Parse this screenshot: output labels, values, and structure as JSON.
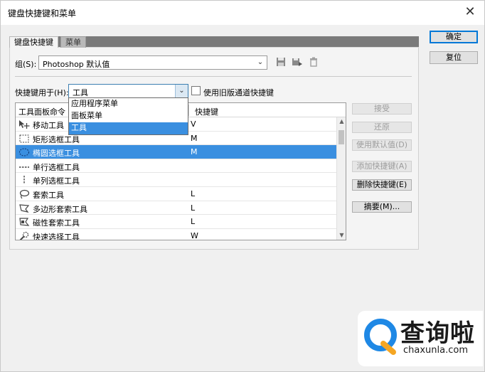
{
  "window": {
    "title": "键盘快捷键和菜单",
    "close_glyph": "✕"
  },
  "tabs": [
    {
      "label": "键盘快捷键",
      "active": true
    },
    {
      "label": "菜单",
      "active": false
    }
  ],
  "group": {
    "label": "组(S):",
    "value": "Photoshop 默认值"
  },
  "shortcuts_for": {
    "label": "快捷键用于(H):",
    "value": "工具",
    "options": [
      "应用程序菜单",
      "面板菜单",
      "工具"
    ],
    "selected_option": "工具"
  },
  "legacy_channel": {
    "label": "使用旧版通道快捷键",
    "checked": false
  },
  "table": {
    "headers": {
      "command": "工具面板命令",
      "shortcut": "快捷键"
    },
    "rows": [
      {
        "icon": "move-tool-icon",
        "name": "移动工具",
        "key": "V",
        "selected": false
      },
      {
        "icon": "rect-marquee-icon",
        "name": "矩形选框工具",
        "key": "M",
        "selected": false
      },
      {
        "icon": "ellipse-marquee-icon",
        "name": "椭圆选框工具",
        "key": "M",
        "selected": true
      },
      {
        "icon": "single-row-marquee-icon",
        "name": "单行选框工具",
        "key": "",
        "selected": false
      },
      {
        "icon": "single-column-marquee-icon",
        "name": "单列选框工具",
        "key": "",
        "selected": false
      },
      {
        "icon": "lasso-icon",
        "name": "套索工具",
        "key": "L",
        "selected": false
      },
      {
        "icon": "polygon-lasso-icon",
        "name": "多边形套索工具",
        "key": "L",
        "selected": false
      },
      {
        "icon": "magnetic-lasso-icon",
        "name": "磁性套索工具",
        "key": "L",
        "selected": false
      },
      {
        "icon": "quick-select-icon",
        "name": "快速选择工具",
        "key": "W",
        "selected": false
      }
    ]
  },
  "side_buttons": {
    "accept": "接受",
    "undo": "还原",
    "use_default": "使用默认值(D)",
    "add_shortcut": "添加快捷键(A)",
    "delete_shortcut": "删除快捷键(E)",
    "summarize": "摘要(M)..."
  },
  "main_buttons": {
    "ok": "确定",
    "reset": "复位"
  },
  "watermark": {
    "text": "查询啦",
    "url": "chaxunla.com"
  },
  "colors": {
    "selection": "#3a8fe0",
    "accent": "#0078d7",
    "watermark_blue": "#1e88e5",
    "watermark_orange": "#f5a623"
  }
}
